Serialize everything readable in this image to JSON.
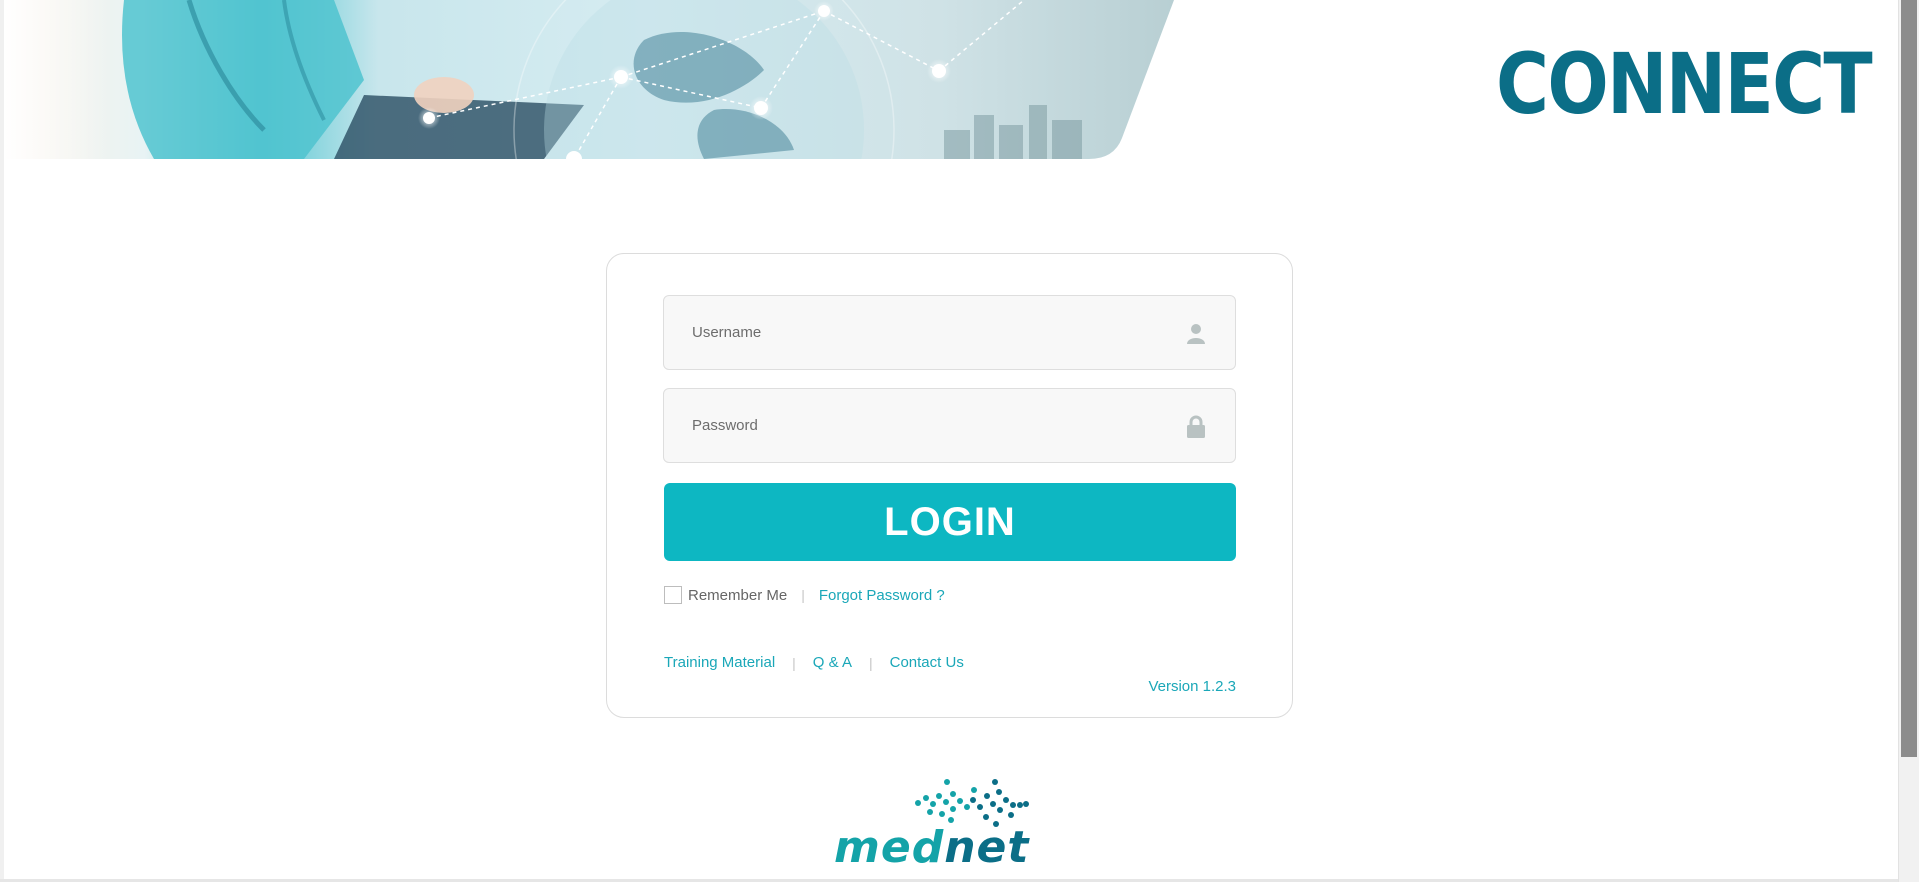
{
  "brand": {
    "title": "CONNECT",
    "logo_text_part1": "med",
    "logo_text_part2": "net"
  },
  "login": {
    "username_placeholder": "Username",
    "password_placeholder": "Password",
    "submit_label": "LOGIN",
    "remember_label": "Remember Me",
    "forgot_label": "Forgot Password ?",
    "user_icon": "user-icon",
    "lock_icon": "lock-icon"
  },
  "footer": {
    "links": [
      "Training Material",
      "Q & A",
      "Contact Us"
    ],
    "separator": "|",
    "version": "Version 1.2.3"
  },
  "colors": {
    "accent": "#0db7c2",
    "link": "#1aa7b8",
    "brand_dark": "#0b6e87",
    "brand_teal": "#14a3a8"
  }
}
